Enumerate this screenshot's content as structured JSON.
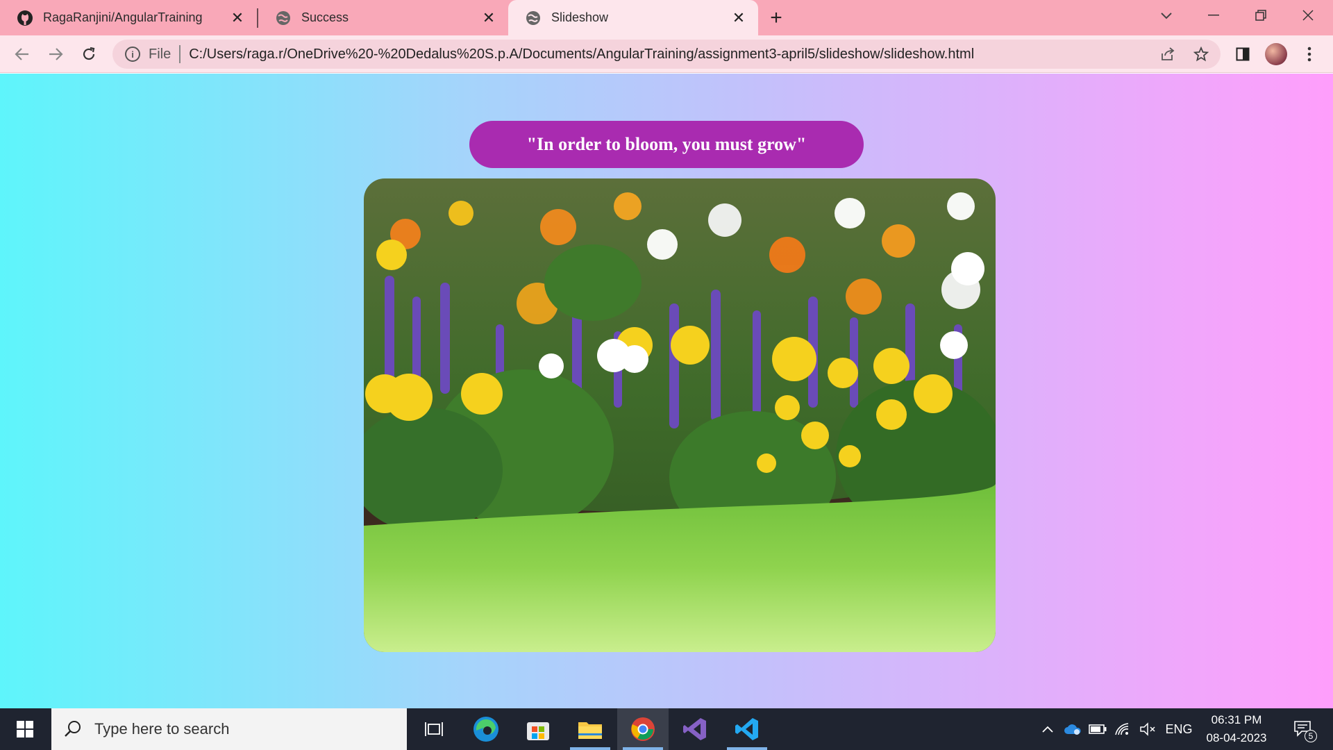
{
  "browser": {
    "tabs": [
      {
        "title": "RagaRanjini/AngularTraining",
        "icon": "github-icon",
        "active": false
      },
      {
        "title": "Success",
        "icon": "globe-icon",
        "active": false
      },
      {
        "title": "Slideshow",
        "icon": "globe-icon",
        "active": true
      }
    ],
    "new_tab_label": "+",
    "address": {
      "scheme_label": "File",
      "url": "C:/Users/raga.r/OneDrive%20-%20Dedalus%20S.p.A/Documents/AngularTraining/assignment3-april5/slideshow/slideshow.html"
    },
    "colors": {
      "tabstrip": "#f9a8b8",
      "toolbar": "#fde6ec"
    }
  },
  "page": {
    "quote": "\"In order to bloom, you must grow\"",
    "slide_image": "flower-garden-photo",
    "colors": {
      "quote_bg": "#a92bb0",
      "gradient_start": "#5ef5fb",
      "gradient_end": "#ff9efb"
    }
  },
  "taskbar": {
    "search_placeholder": "Type here to search",
    "apps": [
      "task-view",
      "edge",
      "store",
      "file-explorer",
      "chrome",
      "visual-studio",
      "vscode"
    ],
    "language": "ENG",
    "time": "06:31 PM",
    "date": "08-04-2023",
    "notification_count": "5"
  }
}
